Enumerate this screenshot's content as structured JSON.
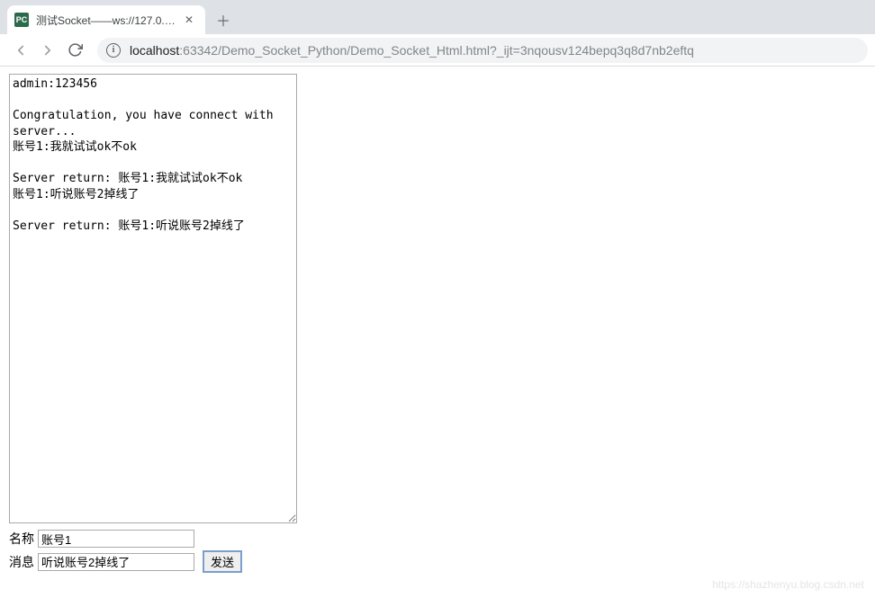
{
  "browser": {
    "tab": {
      "favicon_text": "PC",
      "title": "测试Socket——ws://127.0.0.1:"
    },
    "url": {
      "host": "localhost",
      "rest": ":63342/Demo_Socket_Python/Demo_Socket_Html.html?_ijt=3nqousv124bepq3q8d7nb2eftq"
    }
  },
  "log": "admin:123456\n\nCongratulation, you have connect with server...\n账号1:我就试试ok不ok\n\nServer return: 账号1:我就试试ok不ok\n账号1:听说账号2掉线了\n\nServer return: 账号1:听说账号2掉线了",
  "form": {
    "name_label": "名称",
    "name_value": "账号1",
    "msg_label": "消息",
    "msg_value": "听说账号2掉线了",
    "send_label": "发送"
  },
  "watermark": "https://shazhenyu.blog.csdn.net"
}
